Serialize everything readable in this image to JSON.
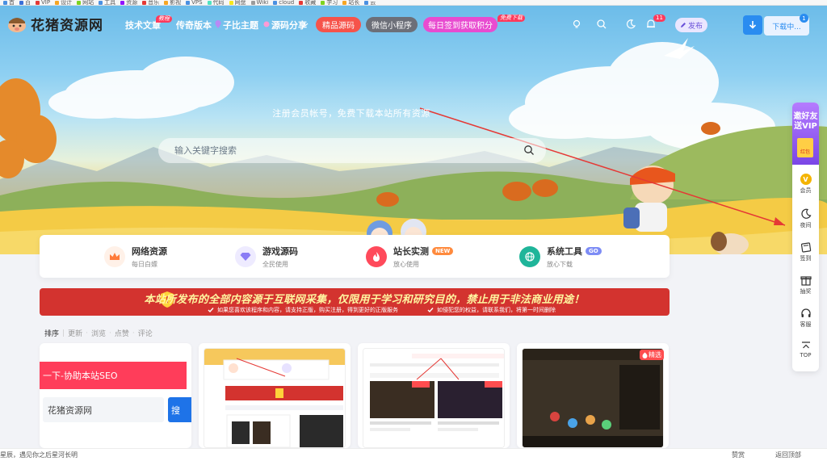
{
  "browser": {
    "bookmarks": [
      {
        "label": "首",
        "color": "#4a90e2"
      },
      {
        "label": "百",
        "color": "#3b6fd8"
      },
      {
        "label": "VIP",
        "color": "#e53935"
      },
      {
        "label": "设计",
        "color": "#f5a623"
      },
      {
        "label": "网站",
        "color": "#7ed321"
      },
      {
        "label": "工具",
        "color": "#4a90e2"
      },
      {
        "label": "资源",
        "color": "#9013fe"
      },
      {
        "label": "音乐",
        "color": "#e53935"
      },
      {
        "label": "影视",
        "color": "#f5a623"
      },
      {
        "label": "VPS",
        "color": "#4a90e2"
      },
      {
        "label": "代码",
        "color": "#50e3c2"
      },
      {
        "label": "网盘",
        "color": "#f8e71c"
      },
      {
        "label": "Wiki",
        "color": "#9b9b9b"
      },
      {
        "label": "cloud",
        "color": "#4a90e2"
      },
      {
        "label": "收藏",
        "color": "#e53935"
      },
      {
        "label": "学习",
        "color": "#7ed321"
      },
      {
        "label": "站长",
        "color": "#f5a623"
      },
      {
        "label": "云",
        "color": "#4a90e2"
      }
    ]
  },
  "site": {
    "logo_text": "花猪资源网",
    "accent": "#2a8cf0"
  },
  "nav": {
    "items": [
      {
        "label": "技术文章",
        "tag": "教程"
      },
      {
        "label": "传奇版本",
        "tag": ""
      },
      {
        "label": "子比主题",
        "tag": ""
      },
      {
        "label": "源码分享",
        "tag": ""
      }
    ],
    "pills": [
      {
        "label": "精品源码",
        "color": "#f6534a"
      },
      {
        "label": "微信小程序",
        "color": "#6c6f78"
      },
      {
        "label": "每日签到获取积分",
        "color": "#e84bd0",
        "tag": "免费下载"
      }
    ],
    "notification_count": "11",
    "publish_label": "发布",
    "download_label": "下载中...",
    "download_count": "1"
  },
  "hero": {
    "subtitle": "注册会员帐号，免费下载本站所有资源",
    "search_placeholder": "输入关键字搜索"
  },
  "categories": [
    {
      "title": "网络资源",
      "sub": "每日白嫖",
      "icon": "crown-icon",
      "color": "#ff7b3a",
      "bg": "#fff1e8",
      "tag": ""
    },
    {
      "title": "游戏源码",
      "sub": "全民使用",
      "icon": "diamond-icon",
      "color": "#8a7cf5",
      "bg": "#eeebff",
      "tag": ""
    },
    {
      "title": "站长实测",
      "sub": "放心使用",
      "icon": "flame-icon",
      "color": "#ff4a5b",
      "bg": "#ff4a5b",
      "tag": "NEW",
      "tag_color": "#ff8a3d"
    },
    {
      "title": "系统工具",
      "sub": "放心下载",
      "icon": "globe-icon",
      "color": "#1fb59a",
      "bg": "#1fb59a",
      "tag": "GO",
      "tag_color": "#7d8cf5"
    }
  ],
  "notice": {
    "main": "本站所发布的全部内容源于互联网采集，仅限用于学习和研究目的，禁止用于非法商业用途！",
    "sub_left": "如果您喜欢该程序和内容，请支持正版，购买注册，得到更好的正版服务",
    "sub_right": "如侵犯您的权益，请联系我们，将第一时间删除"
  },
  "sort": {
    "label": "排序",
    "options": [
      "更新",
      "浏览",
      "点赞",
      "评论"
    ]
  },
  "cards": {
    "card1_band": "一下-协助本站SEO",
    "card1_input": "花猪资源网",
    "card1_btn": "搜",
    "card4_tag": "精选"
  },
  "sidebar": {
    "invite": "邀好友送VIP",
    "envelope": "红包",
    "items": [
      {
        "label": "会员",
        "icon": "vip-coin-icon"
      },
      {
        "label": "夜间",
        "icon": "moon-icon"
      },
      {
        "label": "签到",
        "icon": "calendar-icon"
      },
      {
        "label": "抽奖",
        "icon": "gift-icon"
      },
      {
        "label": "客服",
        "icon": "headset-icon"
      },
      {
        "label": "TOP",
        "icon": "top-arrow-icon"
      }
    ]
  },
  "footer": {
    "left": "星辰，遇见你之后星河长明",
    "praise": "赞赏",
    "back_top": "返回顶部"
  }
}
